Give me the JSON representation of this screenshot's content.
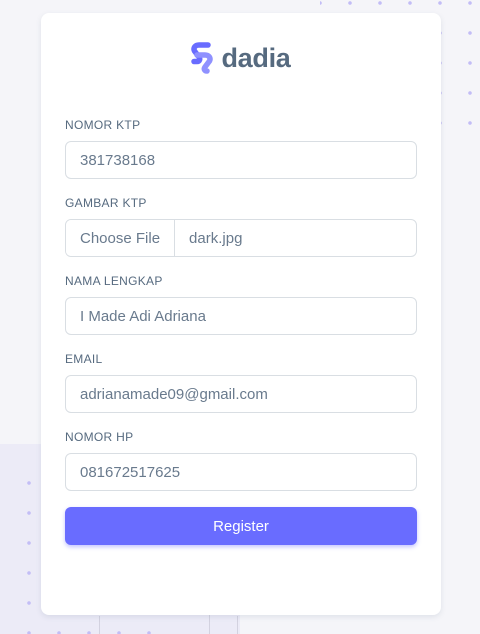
{
  "brand": {
    "name": "dadia",
    "logo_icon": "dadia-s-logo-icon",
    "accent_color": "#696cff",
    "text_color": "#566a7f"
  },
  "form": {
    "nomor_ktp": {
      "label": "NOMOR KTP",
      "value": "381738168"
    },
    "gambar_ktp": {
      "label": "GAMBAR KTP",
      "button_label": "Choose File",
      "file_name": "dark.jpg"
    },
    "nama_lengkap": {
      "label": "NAMA LENGKAP",
      "value": "I Made Adi Adriana"
    },
    "email": {
      "label": "EMAIL",
      "value": "adrianamade09@gmail.com"
    },
    "nomor_hp": {
      "label": "NOMOR HP",
      "value": "081672517625"
    },
    "submit_label": "Register"
  }
}
